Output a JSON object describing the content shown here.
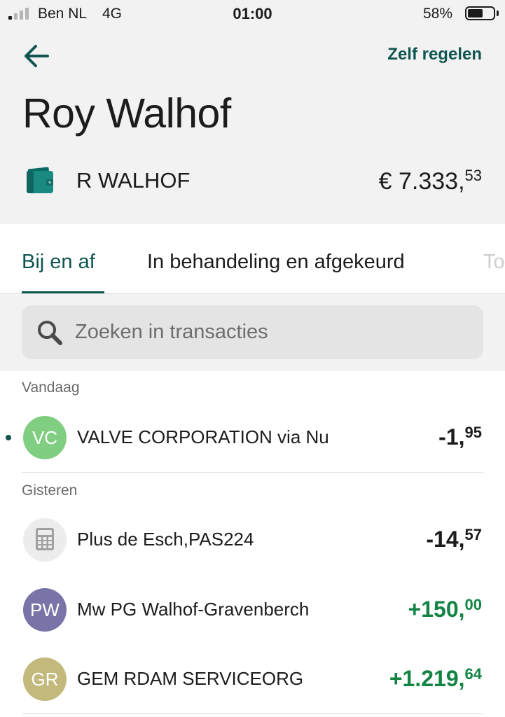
{
  "status_bar": {
    "carrier": "Ben NL",
    "network": "4G",
    "time": "01:00",
    "battery_percent": "58%",
    "battery_level": 0.58
  },
  "header": {
    "back_icon": "arrow-left-icon",
    "action_label": "Zelf regelen",
    "title": "Roy Walhof"
  },
  "account": {
    "icon": "wallet-icon",
    "name": "R WALHOF",
    "balance_main": "€ 7.333,",
    "balance_cents": "53"
  },
  "tabs": [
    {
      "label": "Bij en af",
      "active": true
    },
    {
      "label": "In behandeling en afgekeurd",
      "active": false
    },
    {
      "label": "To",
      "active": false
    }
  ],
  "search": {
    "icon": "search-icon",
    "placeholder": "Zoeken in transacties"
  },
  "sections": [
    {
      "label": "Vandaag",
      "transactions": [
        {
          "initials": "VC",
          "avatar_color": "#7fce82",
          "name": "VALVE CORPORATION via Nu",
          "amount_main": "-1,",
          "amount_cents": "95",
          "positive": false,
          "unread": true
        }
      ]
    },
    {
      "label": "Gisteren",
      "transactions": [
        {
          "initials": "",
          "icon": "calculator-icon",
          "avatar_color": "#ececec",
          "name": "Plus de Esch,PAS224",
          "amount_main": "-14,",
          "amount_cents": "57",
          "positive": false,
          "unread": false
        },
        {
          "initials": "PW",
          "avatar_color": "#7874a8",
          "name": "Mw PG Walhof-Gravenberch",
          "amount_main": "+150,",
          "amount_cents": "00",
          "positive": true,
          "unread": false
        },
        {
          "initials": "GR",
          "avatar_color": "#c4b97c",
          "name": "GEM RDAM SERVICEORG",
          "amount_main": "+1.219,",
          "amount_cents": "64",
          "positive": true,
          "unread": false
        }
      ]
    }
  ],
  "colors": {
    "accent": "#0f5550",
    "positive": "#128444",
    "header_bg": "#f2f2f2"
  }
}
